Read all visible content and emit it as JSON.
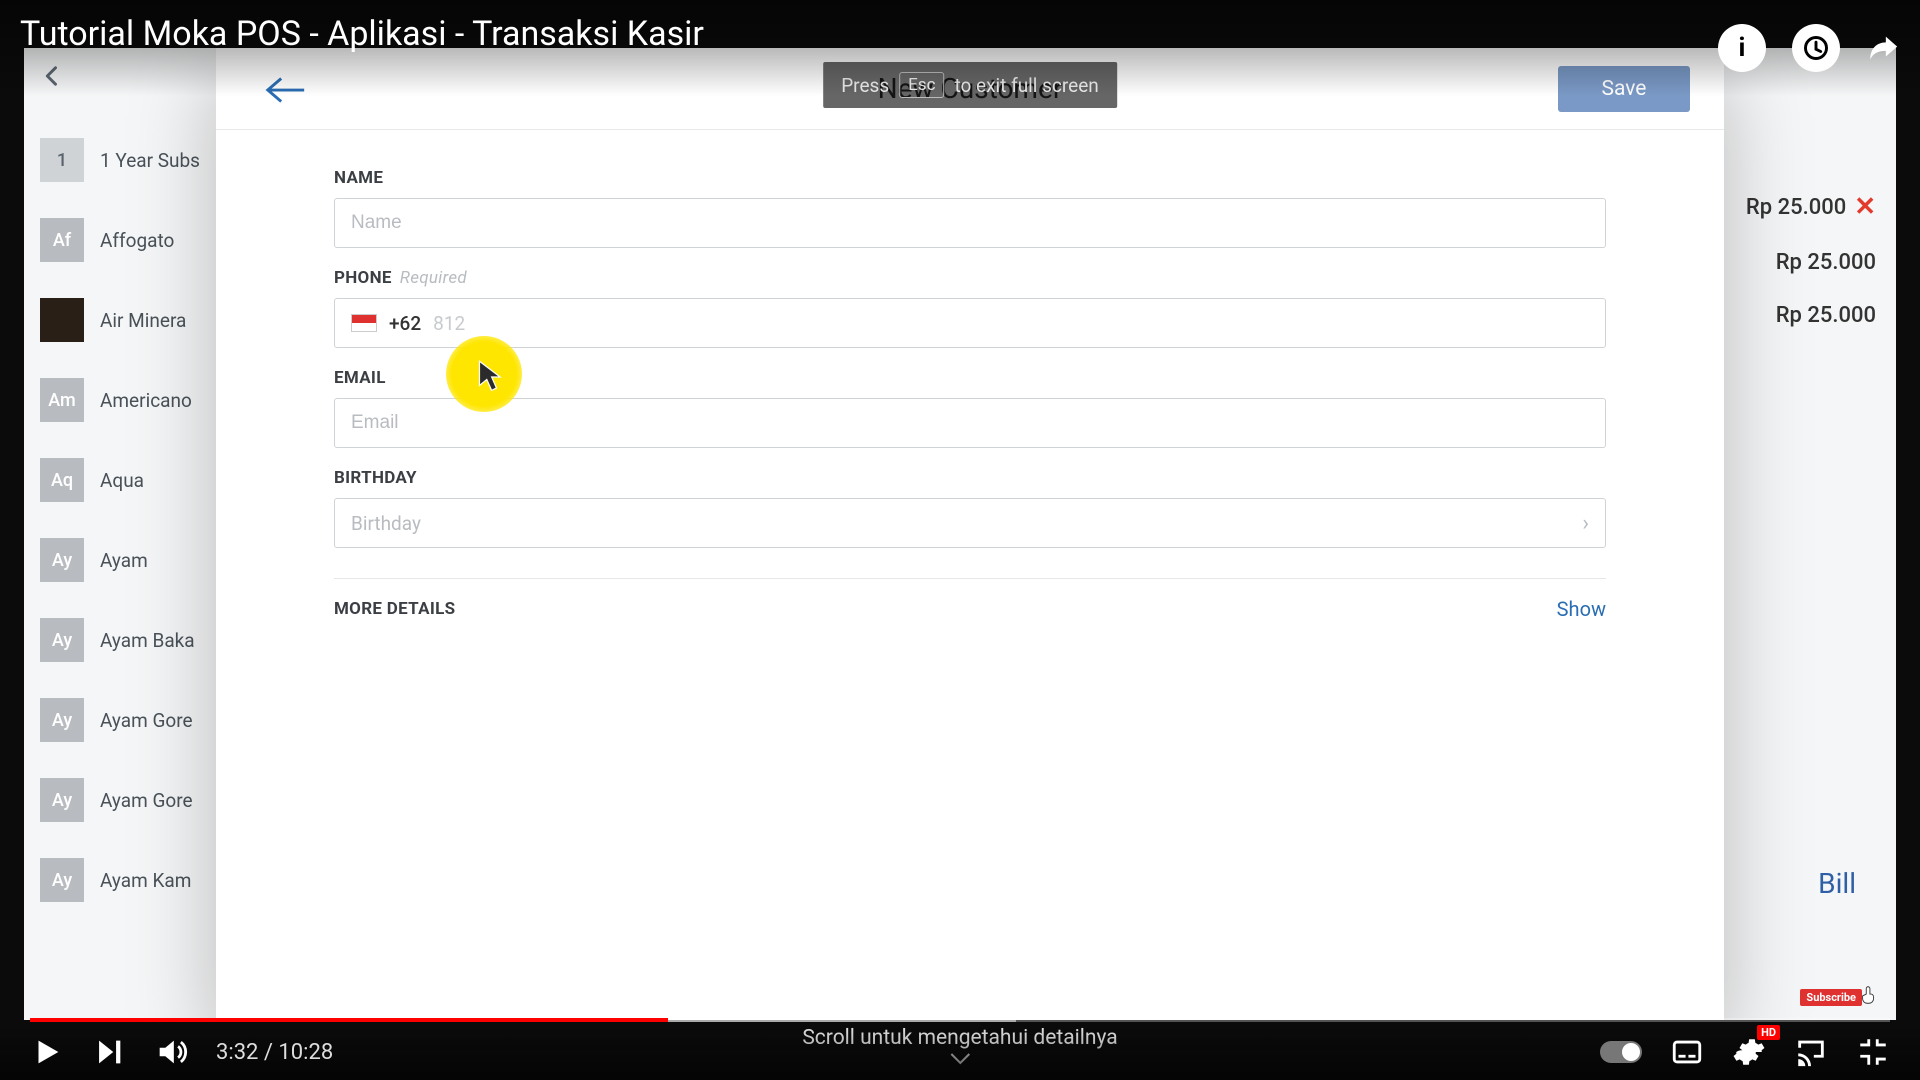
{
  "video": {
    "title": "Tutorial Moka POS - Aplikasi - Transaksi Kasir",
    "current_time": "3:32",
    "duration": "10:28",
    "played_percent": 34.3,
    "scroll_hint": "Scroll untuk mengetahui detailnya",
    "esc_hint_pre": "Press",
    "esc_key": "Esc",
    "esc_hint_post": "to exit full screen",
    "hd_label": "HD",
    "subscribe_label": "Subscribe"
  },
  "top_icons": {
    "info": "i"
  },
  "pos_bg": {
    "items": [
      {
        "thumb": "1",
        "thumb_kind": "num",
        "label": "1 Year Subs"
      },
      {
        "thumb": "Af",
        "thumb_kind": "txt",
        "label": "Affogato"
      },
      {
        "thumb": "",
        "thumb_kind": "img",
        "label": "Air Minera"
      },
      {
        "thumb": "Am",
        "thumb_kind": "txt",
        "label": "Americano"
      },
      {
        "thumb": "Aq",
        "thumb_kind": "txt",
        "label": "Aqua"
      },
      {
        "thumb": "Ay",
        "thumb_kind": "txt",
        "label": "Ayam"
      },
      {
        "thumb": "Ay",
        "thumb_kind": "txt",
        "label": "Ayam Baka"
      },
      {
        "thumb": "Ay",
        "thumb_kind": "txt",
        "label": "Ayam Gore"
      },
      {
        "thumb": "Ay",
        "thumb_kind": "txt",
        "label": "Ayam Gore"
      },
      {
        "thumb": "Ay",
        "thumb_kind": "txt",
        "label": "Ayam Kam"
      }
    ],
    "prices": [
      "Rp 25.000",
      "Rp 25.000",
      "Rp 25.000"
    ],
    "bill_label": "Bill"
  },
  "modal": {
    "title": "New Customer",
    "save": "Save",
    "name_label": "NAME",
    "name_placeholder": "Name",
    "phone_label": "PHONE",
    "phone_required": "Required",
    "dial_code": "+62",
    "phone_placeholder": "812",
    "email_label": "EMAIL",
    "email_placeholder": "Email",
    "birthday_label": "BIRTHDAY",
    "birthday_placeholder": "Birthday",
    "more_label": "MORE DETAILS",
    "show": "Show"
  }
}
